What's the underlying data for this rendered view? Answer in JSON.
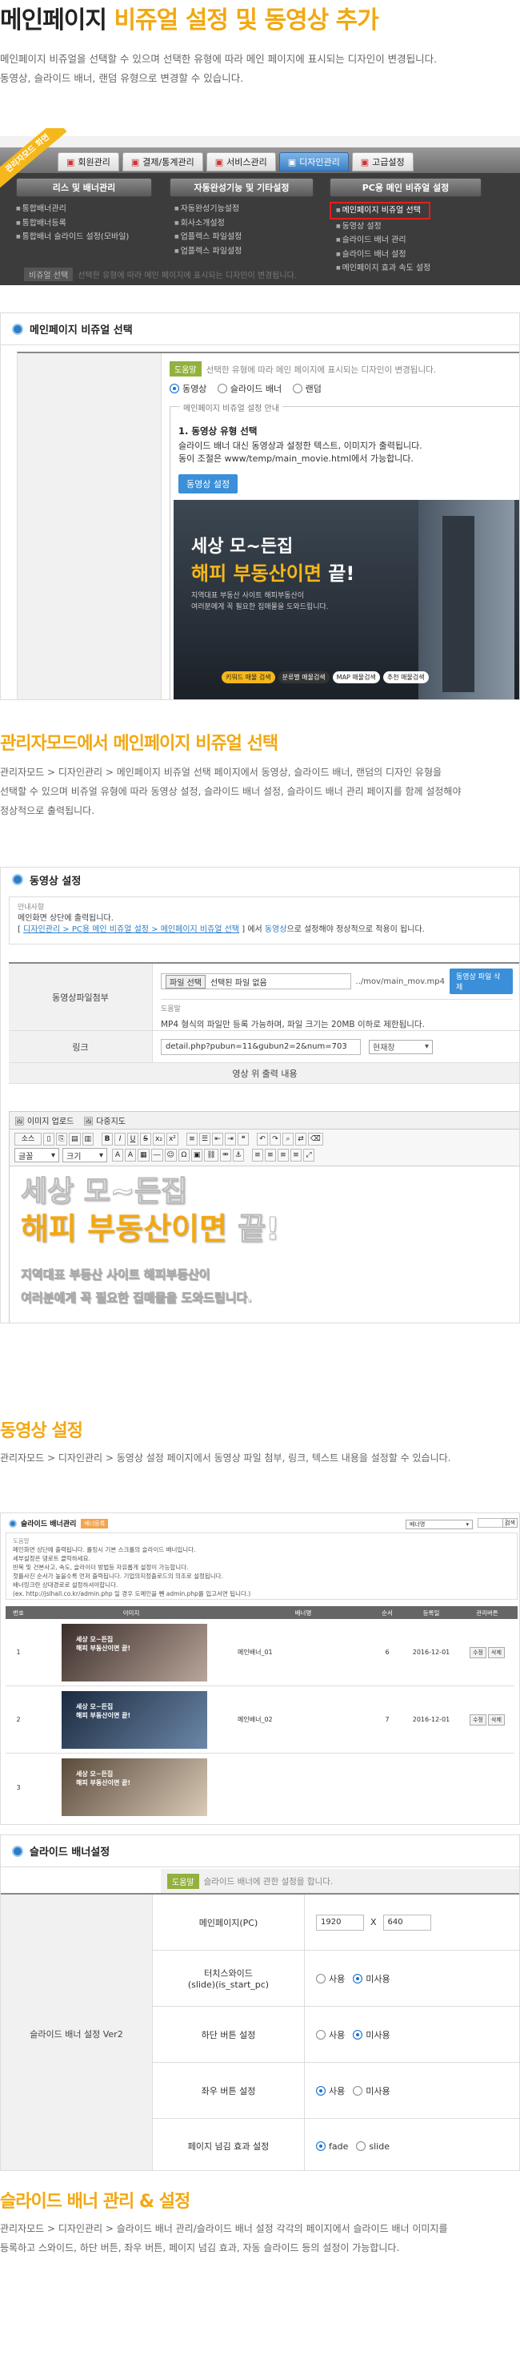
{
  "intro": {
    "title_plain": "메인페이지 ",
    "title_highlight": "비쥬얼 설정 및 동영상 추가",
    "desc": "메인페이지 비쥬얼을 선택할 수 있으며 선택한 유형에 따라 메인 페이지에 표시되는 디자인이 변경됩니다.\n동영상, 슬라이드 배너, 랜덤 유형으로 변경할 수 있습니다."
  },
  "admin_nav": {
    "ribbon": "관리자모드 화면",
    "tabs": [
      "회원관리",
      "결제/통계관리",
      "서비스관리",
      "디자인관리",
      "고급설정"
    ],
    "active_tab": "디자인관리",
    "section1": "리스 및 배너관리",
    "section2": "자동완성기능 및 기타설정",
    "section3": "PC용 메인 비쥬얼 설정",
    "col1": [
      "통합배너관리",
      "통합배너등록",
      "통합배너 슬라이드 설정(모바일)"
    ],
    "col2": [
      "자동완성기능설정",
      "회사소개설정",
      "업플렉스 파일설정",
      "업플렉스 파일설정"
    ],
    "col3": [
      "메인페이지 비쥬얼 선택",
      "동영상 설정",
      "슬라이드 배너 관리",
      "슬라이드 배너 설정",
      "메인페이지 효과 속도 설정"
    ],
    "highlight_item": "메인페이지 비쥬얼 선택",
    "footer_label": "비쥬얼 선택",
    "footer_text": "선택한 유형에 따라 메인 페이지에 표시되는 디자인이 변경됩니다."
  },
  "visual_select": {
    "panel_title": "메인페이지 비쥬얼 선택",
    "badge": "도움말",
    "help": "선택한 유형에 따라 메인 페이지에 표시되는 디자인이 변경됩니다.",
    "options": [
      "동영상",
      "슬라이드 배너",
      "랜덤"
    ],
    "selected": "동영상",
    "guide_legend": "메인페이지 비쥬얼 설정 안내",
    "guide_title": "1. 동영상 유형 선택",
    "guide_line1": "슬라이드 배너 대신 동영상과 설정한 텍스트, 이미지가 출력됩니다.",
    "guide_line2": "동이 조절은 www/temp/main_movie.html에서 가능합니다.",
    "button": "동영상 설정",
    "promo_line1": "세상 모~든집",
    "promo_line2a": "해피 부동산이면",
    "promo_line2b": " 끝!",
    "promo_small1": "지역대표 부동산 사이트 해피부동산이",
    "promo_small2": "여러분에게 꼭 필요한 집매물을 도와드립니다.",
    "promo_btn1": "키워드 매물 검색",
    "promo_btn2": "분류별 매물검색",
    "promo_btn3": "MAP 매물검색",
    "promo_btn4": "추천 매물검색"
  },
  "section1": {
    "title": "관리자모드에서 메인페이지 비쥬얼 선택",
    "desc": "관리자모드 > 디자인관리 > 메인페이지 비쥬얼 선택 페이지에서 동영상, 슬라이드 배너, 랜덤의 디자인 유형을\n선택할 수 있으며 비쥬얼 유형에 따라 동영상 설정, 슬라이드 배너 설정, 슬라이드 배너 관리 페이지를 함께 설정해야\n정상적으로 출력됩니다."
  },
  "video_settings": {
    "panel_title": "동영상 설정",
    "notice_label": "안내사항",
    "notice1": "메인화면 상단에 출력됩니다.",
    "notice2_prefix": "[ ",
    "notice2_link": "디자인관리 > PC용 메인 비쥬얼 설정 > 메인페이지 비쥬얼 선택",
    "notice2_mid": " ] 에서 ",
    "notice2_word": "동영상",
    "notice2_suffix": "으로 설정해야 정상적으로 적용이 됩니다.",
    "file_label": "동영상파일첨부",
    "file_btn": "파일 선택",
    "file_none": "선택된 파일 없음",
    "file_path": "../mov/main_mov.mp4",
    "file_action": "동영상 파일 삭제",
    "file_help_badge": "도움말",
    "file_help": "MP4 형식의 파일만 등록 가능하며, 파일 크기는 20MB 이하로 제한됩니다.",
    "link_label": "링크",
    "link_value": "detail.php?pubun=11&gubun2=2&num=703",
    "link_target": "현재창",
    "content_header": "영상 위 출력 내용",
    "upload_img": "이미지 업로드",
    "upload_multi": "다중지도",
    "editor_source": "소스",
    "editor_format": "글꼴",
    "editor_size": "크기",
    "editor_line1": "세상 모~든집",
    "editor_line2a": "해피 부동산이면",
    "editor_line2b": " 끝!",
    "editor_line3": "지역대표 부동산 사이트 해피부동산이",
    "editor_line4": "여러분에게 꼭 필요한 집매물을 도와드립니다."
  },
  "section2": {
    "title": "동영상 설정",
    "desc": "관리자모드 > 디자인관리 > 동영상 설정 페이지에서 동영상 파일 첨부, 링크, 텍스트 내용을 설정할 수 있습니다."
  },
  "banner_manage": {
    "panel_title": "슬라이드 배너관리",
    "add_btn": "배너등록",
    "select_value": "배너명",
    "search_btn": "검색",
    "help_badge": "도움말",
    "help_lines": [
      "메인화면 상단에 출력됩니다. 롤링시 기본 스크롤의 슬라이드 배너입니다.",
      "세부설정은 댕로트 클릭하세요.",
      "반복 및 건본사고, 속도, 슬라이더 방법등 자유롭게 설정이 가능합니다.",
      "첫를사진 순서가 높을수록 먼저 출력됩니다. 기업의지정출로드의 의조로 설정됩니다.",
      "배너링크란 상대경로로 설정하셔야합니다.",
      "(ex. http://jslhall.co.kr/admin.php 일 경우 도메인을 뺀 admin.php를 입고서면 됩니다.)"
    ],
    "columns": [
      "번호",
      "이미지",
      "배너명",
      "순서",
      "등록일",
      "관리버튼"
    ],
    "rows": [
      {
        "num": "1",
        "name": "메인배너_01",
        "order": "6",
        "date": "2016-12-01"
      },
      {
        "num": "2",
        "name": "메인배너_02",
        "order": "7",
        "date": "2016-12-01"
      },
      {
        "num": "3",
        "name": "",
        "order": "",
        "date": ""
      }
    ],
    "thumb_text1": "세상 모~든집",
    "thumb_text2": "해피 부동산이면 끝!",
    "edit_btn": "수정",
    "delete_btn": "삭제"
  },
  "slide_settings": {
    "panel_title": "슬라이드 배너설정",
    "badge": "도움말",
    "help": "슬라이드 배너에 관한 설정을 합니다.",
    "group_label": "슬라이드 배너 설정 Ver2",
    "rows": [
      {
        "label": "메인페이지(PC)",
        "type": "size",
        "w": "1920",
        "x": "X",
        "h": "640"
      },
      {
        "label": "터치스와이드\n(slide)(is_start_pc)",
        "type": "radio",
        "options": [
          "사용",
          "미사용"
        ],
        "selected": "미사용"
      },
      {
        "label": "하단 버튼 설정",
        "type": "radio",
        "options": [
          "사용",
          "미사용"
        ],
        "selected": "미사용"
      },
      {
        "label": "좌우 버튼 설정",
        "type": "radio",
        "options": [
          "사용",
          "미사용"
        ],
        "selected": "사용"
      },
      {
        "label": "페이지 넘김 효과 설정",
        "type": "radio",
        "options": [
          "fade",
          "slide"
        ],
        "selected": "fade"
      }
    ]
  },
  "section3": {
    "title": "슬라이드 배너 관리 & 설정",
    "desc": "관리자모드 > 디자인관리 > 슬라이드 배너 관리/슬라이드 배너 설정 각각의 페이지에서 슬라이드 배너 이미지를\n등록하고 스와이드, 하단 버튼, 좌우 버튼, 페이지 넘김 효과, 자동 슬라이드 등의 설정이 가능합니다."
  },
  "colors": {
    "accent": "#f2a812",
    "blue": "#2d7dc5",
    "green": "#93b13e",
    "red": "#e02020"
  }
}
